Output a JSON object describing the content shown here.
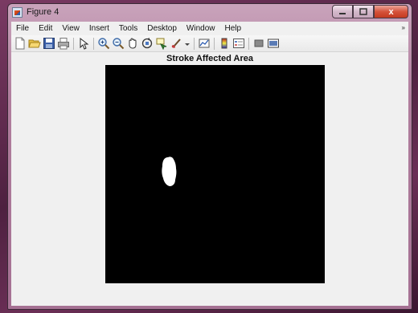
{
  "window": {
    "title": "Figure 4",
    "close_glyph": "x"
  },
  "menu": {
    "items": [
      "File",
      "Edit",
      "View",
      "Insert",
      "Tools",
      "Desktop",
      "Window",
      "Help"
    ],
    "overflow_glyph": "»"
  },
  "toolbar": {
    "icons": [
      "new-figure-icon",
      "open-file-icon",
      "save-figure-icon",
      "print-figure-icon",
      "edit-plot-icon",
      "zoom-in-icon",
      "zoom-out-icon",
      "pan-icon",
      "rotate-3d-icon",
      "data-cursor-icon",
      "brush-icon",
      "link-plot-icon",
      "insert-colorbar-icon",
      "insert-legend-icon",
      "hide-plot-tools-icon",
      "show-plot-tools-icon"
    ]
  },
  "figure": {
    "axes_title": "Stroke Affected Area",
    "background_color": "#000000",
    "region_color": "#ffffff"
  }
}
